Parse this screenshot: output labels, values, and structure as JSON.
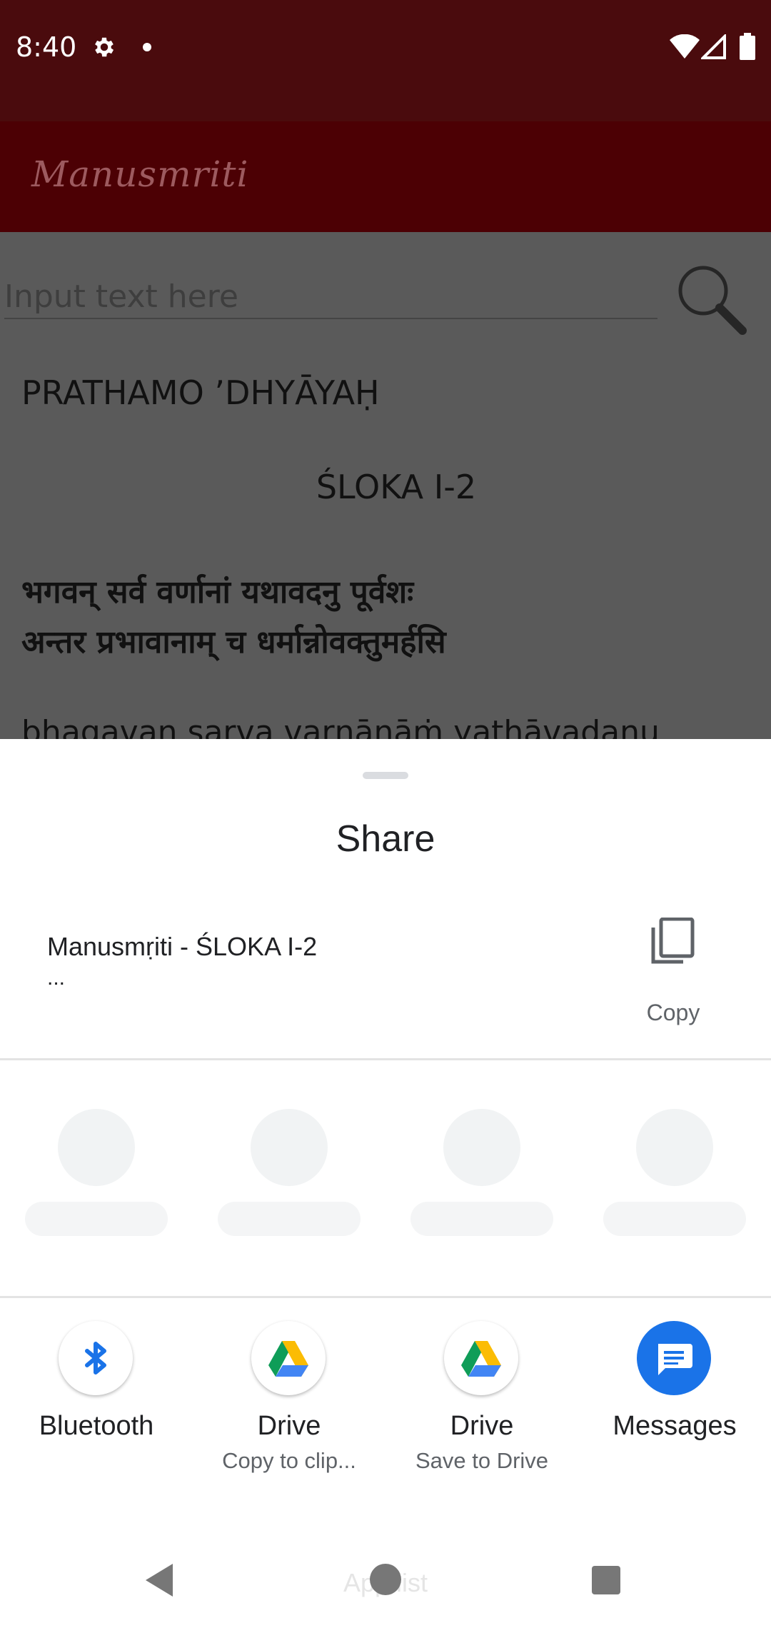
{
  "status_bar": {
    "time": "8:40",
    "icons": [
      "gear-icon",
      "notification-dot-icon",
      "wifi-icon",
      "signal-icon",
      "battery-icon"
    ]
  },
  "app": {
    "title": "Manusmriti",
    "search_placeholder": "Input text here",
    "chapter_title": "PRATHAMO ʼDHYĀYAḤ",
    "sloka_title": "ŚLOKA I-2",
    "sanskrit_line1": "भगवन् सर्व वर्णानां यथावदनु पूर्वशः",
    "sanskrit_line2": "अन्तर प्रभावानाम् च धर्मान्नोवक्तुमर्हसि",
    "transliteration": "bhagavan sarva varṇānāṁ yathāvadanu"
  },
  "share_sheet": {
    "title": "Share",
    "preview_title": "Manusmṛiti -  ŚLOKA I-2",
    "preview_ellipsis": "...",
    "copy_label": "Copy",
    "targets": [
      {
        "label": "Bluetooth",
        "sub": "",
        "icon": "bluetooth-icon"
      },
      {
        "label": "Drive",
        "sub": "Copy to clip...",
        "icon": "google-drive-icon"
      },
      {
        "label": "Drive",
        "sub": "Save to Drive",
        "icon": "google-drive-icon"
      },
      {
        "label": "Messages",
        "sub": "",
        "icon": "messages-icon"
      }
    ]
  },
  "nav_bar": {
    "hint": "App list"
  },
  "colors": {
    "status_bar": "#4a0b0d",
    "app_bar": "#4c0004",
    "messages_blue": "#1a73e8",
    "bluetooth_blue": "#1a73e8"
  }
}
